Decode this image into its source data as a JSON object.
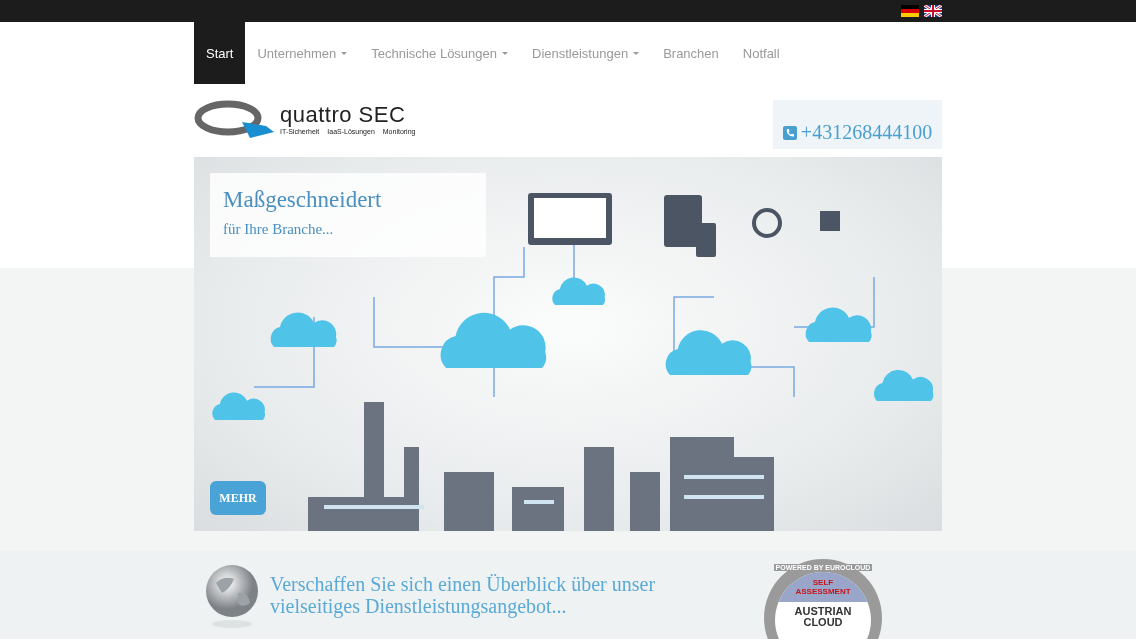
{
  "language_flags": [
    {
      "kind": "de"
    },
    {
      "kind": "en"
    }
  ],
  "nav": [
    {
      "label": "Start",
      "selected": true,
      "dropdown": false
    },
    {
      "label": "Unternehmen",
      "selected": false,
      "dropdown": true
    },
    {
      "label": "Technische Lösungen",
      "selected": false,
      "dropdown": true
    },
    {
      "label": "Dienstleistungen",
      "selected": false,
      "dropdown": true
    },
    {
      "label": "Branchen",
      "selected": false,
      "dropdown": false
    },
    {
      "label": "Notfall",
      "selected": false,
      "dropdown": false
    }
  ],
  "logo": {
    "name": "quattro SEC",
    "taglines": [
      "IT-Sicherheit",
      "IaaS-Lösungen",
      "Monitoring"
    ]
  },
  "phone": "+431268444100",
  "hero": {
    "title": "Maßgeschneidert",
    "subtitle": "für Ihre Branche...",
    "button": "MEHR"
  },
  "intro": {
    "text": "Verschaffen Sie sich einen Überblick über unser vielseitiges Dienstleistungsangebot..."
  },
  "badge": {
    "ring_text": "POWERED BY EUROCLOUD",
    "top": "SELF ASSESSMENT",
    "brand_lines": [
      "AUSTRIAN",
      "CLOUD"
    ]
  }
}
